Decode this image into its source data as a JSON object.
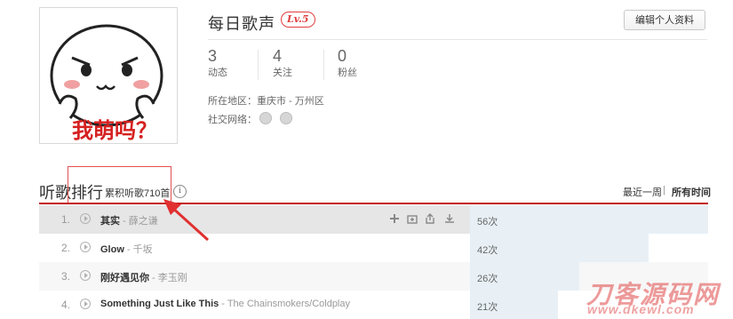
{
  "profile": {
    "avatar_caption": "我萌吗？",
    "name": "每日歌声",
    "level": "Lv.5",
    "edit_button": "编辑个人资料",
    "stats": [
      {
        "num": "3",
        "label": "动态"
      },
      {
        "num": "4",
        "label": "关注"
      },
      {
        "num": "0",
        "label": "粉丝"
      }
    ],
    "region_label": "所在地区：",
    "region_value": "重庆市 - 万州区",
    "social_label": "社交网络："
  },
  "ranking": {
    "title": "听歌排行",
    "total": "累积听歌710首",
    "info_glyph": "i",
    "tab_week": "最近一周",
    "tab_separator": "|",
    "tab_all": "所有时间",
    "rows": [
      {
        "idx": "1.",
        "song": "其实",
        "artist": " - 薛之谦",
        "count": "56次",
        "bar": 1.0
      },
      {
        "idx": "2.",
        "song": "Glow",
        "artist": " - 千坂",
        "count": "42次",
        "bar": 0.75
      },
      {
        "idx": "3.",
        "song": "刚好遇见你",
        "artist": " - 李玉刚",
        "count": "26次",
        "bar": 0.46
      },
      {
        "idx": "4.",
        "song": "Something Just Like This",
        "artist": " - The Chainsmokers/Coldplay",
        "count": "21次",
        "bar": 0.37
      }
    ]
  },
  "watermark": {
    "line1": "刀客源码网",
    "line2": "www.dkewl.com"
  },
  "colors": {
    "accent_red": "#c20c0c",
    "bar_blue": "#e8f0f6",
    "level_red": "#e03e3e"
  }
}
